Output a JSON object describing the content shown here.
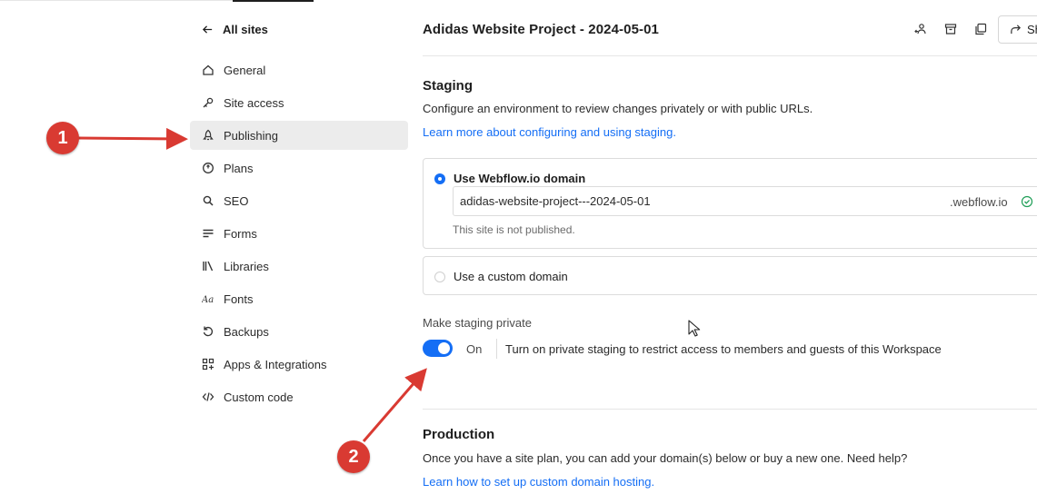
{
  "sidebar": {
    "back_label": "All sites",
    "items": [
      {
        "label": "General",
        "icon": "house-icon"
      },
      {
        "label": "Site access",
        "icon": "key-icon"
      },
      {
        "label": "Publishing",
        "icon": "rocket-icon",
        "active": true
      },
      {
        "label": "Plans",
        "icon": "plan-icon"
      },
      {
        "label": "SEO",
        "icon": "search-icon"
      },
      {
        "label": "Forms",
        "icon": "form-lines-icon"
      },
      {
        "label": "Libraries",
        "icon": "libraries-icon"
      },
      {
        "label": "Fonts",
        "icon": "font-icon"
      },
      {
        "label": "Backups",
        "icon": "backup-icon"
      },
      {
        "label": "Apps & Integrations",
        "icon": "apps-grid-icon"
      },
      {
        "label": "Custom code",
        "icon": "code-icon"
      }
    ]
  },
  "header": {
    "title": "Adidas Website Project - 2024-05-01",
    "share_label": "Sh"
  },
  "staging": {
    "title": "Staging",
    "description": "Configure an environment to review changes privately or with public URLs.",
    "learn_more": "Learn more about configuring and using staging.",
    "webflow_option": "Use Webflow.io domain",
    "subdomain_value": "adidas-website-project---2024-05-01",
    "domain_suffix": ".webflow.io",
    "not_published": "This site is not published.",
    "custom_option": "Use a custom domain",
    "private_label": "Make staging private",
    "toggle_state": "On",
    "toggle_description": "Turn on private staging to restrict access to members and guests of this Workspace"
  },
  "production": {
    "title": "Production",
    "description": "Once you have a site plan, you can add your domain(s) below or buy a new one. Need help?",
    "link": "Learn how to set up custom domain hosting."
  },
  "annotations": {
    "badge_1": "1",
    "badge_2": "2",
    "color": "#d93a32"
  },
  "colors": {
    "accent": "#146ef5",
    "active_nav_bg": "#ececec",
    "valid_check": "#1f9e57"
  }
}
